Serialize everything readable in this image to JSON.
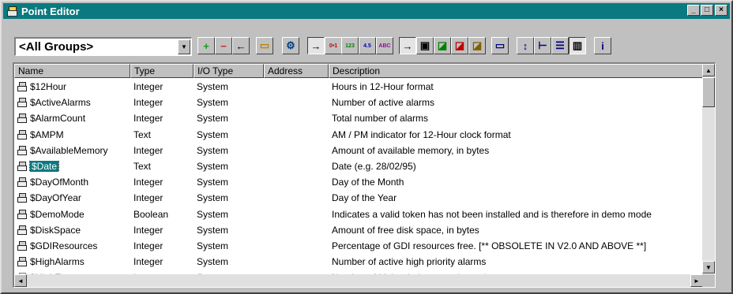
{
  "window": {
    "title": "Point Editor",
    "icon": "point-editor-icon",
    "controls": [
      "minimize",
      "maximize",
      "close"
    ]
  },
  "toolbar": {
    "group_select": {
      "value": "<All Groups>"
    },
    "buttons": [
      {
        "name": "add-point-button",
        "icon": "plus-icon",
        "glyph": "+",
        "color": "#1a9a1a"
      },
      {
        "name": "delete-point-button",
        "icon": "minus-icon",
        "glyph": "−",
        "color": "#d02020"
      },
      {
        "name": "back-button",
        "icon": "arrow-left-icon",
        "glyph": "←",
        "color": "#000000"
      },
      {
        "name": "tag-button",
        "icon": "tag-icon",
        "glyph": "▭",
        "color": "#c08000"
      },
      {
        "name": "properties-button",
        "icon": "properties-icon",
        "glyph": "⚙",
        "color": "#004080"
      },
      {
        "name": "arrow-mode-button",
        "icon": "arrow-right-icon",
        "glyph": "→",
        "color": "#000000",
        "pressed": true
      },
      {
        "name": "boolean-filter-button",
        "icon": "boolean-icon",
        "glyph": "0•1",
        "color": "#c00000"
      },
      {
        "name": "integer-filter-button",
        "icon": "integer-icon",
        "glyph": "123",
        "color": "#008000"
      },
      {
        "name": "real-filter-button",
        "icon": "real-icon",
        "glyph": "4.5",
        "color": "#0000c0"
      },
      {
        "name": "text-filter-button",
        "icon": "text-icon",
        "glyph": "ABC",
        "color": "#a000a0"
      },
      {
        "name": "arrow-mode-2-button",
        "icon": "arrow-right-icon",
        "glyph": "→",
        "color": "#000000",
        "pressed": true
      },
      {
        "name": "system-filter-button",
        "icon": "system-point-icon",
        "glyph": "▣",
        "color": "#000000"
      },
      {
        "name": "io-filter-1-button",
        "icon": "io-point-icon",
        "glyph": "◪",
        "color": "#008000"
      },
      {
        "name": "io-filter-2-button",
        "icon": "io-point-icon",
        "glyph": "◪",
        "color": "#c00000"
      },
      {
        "name": "io-filter-3-button",
        "icon": "io-point-icon",
        "glyph": "◪",
        "color": "#806000"
      },
      {
        "name": "window-view-button",
        "icon": "window-icon",
        "glyph": "▭",
        "color": "#000080"
      },
      {
        "name": "sort-button",
        "icon": "sort-icon",
        "glyph": "↕",
        "color": "#000080"
      },
      {
        "name": "tree-view-button",
        "icon": "tree-view-icon",
        "glyph": "⊢",
        "color": "#000080"
      },
      {
        "name": "list-view-button",
        "icon": "list-view-icon",
        "glyph": "☰",
        "color": "#000080"
      },
      {
        "name": "details-view-button",
        "icon": "details-view-icon",
        "glyph": "▥",
        "color": "#000000",
        "pressed": true
      },
      {
        "name": "info-button",
        "icon": "info-icon",
        "glyph": "i",
        "color": "#000080"
      }
    ]
  },
  "grid": {
    "columns": [
      "Name",
      "Type",
      "I/O Type",
      "Address",
      "Description"
    ],
    "rows": [
      {
        "name": "$12Hour",
        "type": "Integer",
        "io": "System",
        "address": "",
        "description": "Hours in 12-Hour format"
      },
      {
        "name": "$ActiveAlarms",
        "type": "Integer",
        "io": "System",
        "address": "",
        "description": "Number of active alarms"
      },
      {
        "name": "$AlarmCount",
        "type": "Integer",
        "io": "System",
        "address": "",
        "description": "Total number of alarms"
      },
      {
        "name": "$AMPM",
        "type": "Text",
        "io": "System",
        "address": "",
        "description": "AM / PM indicator for 12-Hour clock format"
      },
      {
        "name": "$AvailableMemory",
        "type": "Integer",
        "io": "System",
        "address": "",
        "description": "Amount of available memory, in bytes"
      },
      {
        "name": "$Date",
        "type": "Text",
        "io": "System",
        "address": "",
        "description": "Date (e.g. 28/02/95)",
        "selected": true
      },
      {
        "name": "$DayOfMonth",
        "type": "Integer",
        "io": "System",
        "address": "",
        "description": "Day of the Month"
      },
      {
        "name": "$DayOfYear",
        "type": "Integer",
        "io": "System",
        "address": "",
        "description": "Day of the Year"
      },
      {
        "name": "$DemoMode",
        "type": "Boolean",
        "io": "System",
        "address": "",
        "description": "Indicates a valid token has not been installed and is therefore in demo mode"
      },
      {
        "name": "$DiskSpace",
        "type": "Integer",
        "io": "System",
        "address": "",
        "description": "Amount of free disk space, in bytes"
      },
      {
        "name": "$GDIResources",
        "type": "Integer",
        "io": "System",
        "address": "",
        "description": "Percentage of GDI resources free.  [** OBSOLETE  IN  V2.0  AND  ABOVE **]"
      },
      {
        "name": "$HighAlarms",
        "type": "Integer",
        "io": "System",
        "address": "",
        "description": "Number of active high priority alarms"
      },
      {
        "name": "$HighErrors",
        "type": "Integer",
        "io": "System",
        "address": "",
        "description": "Number of high priority errors logged",
        "partial": true
      }
    ]
  }
}
